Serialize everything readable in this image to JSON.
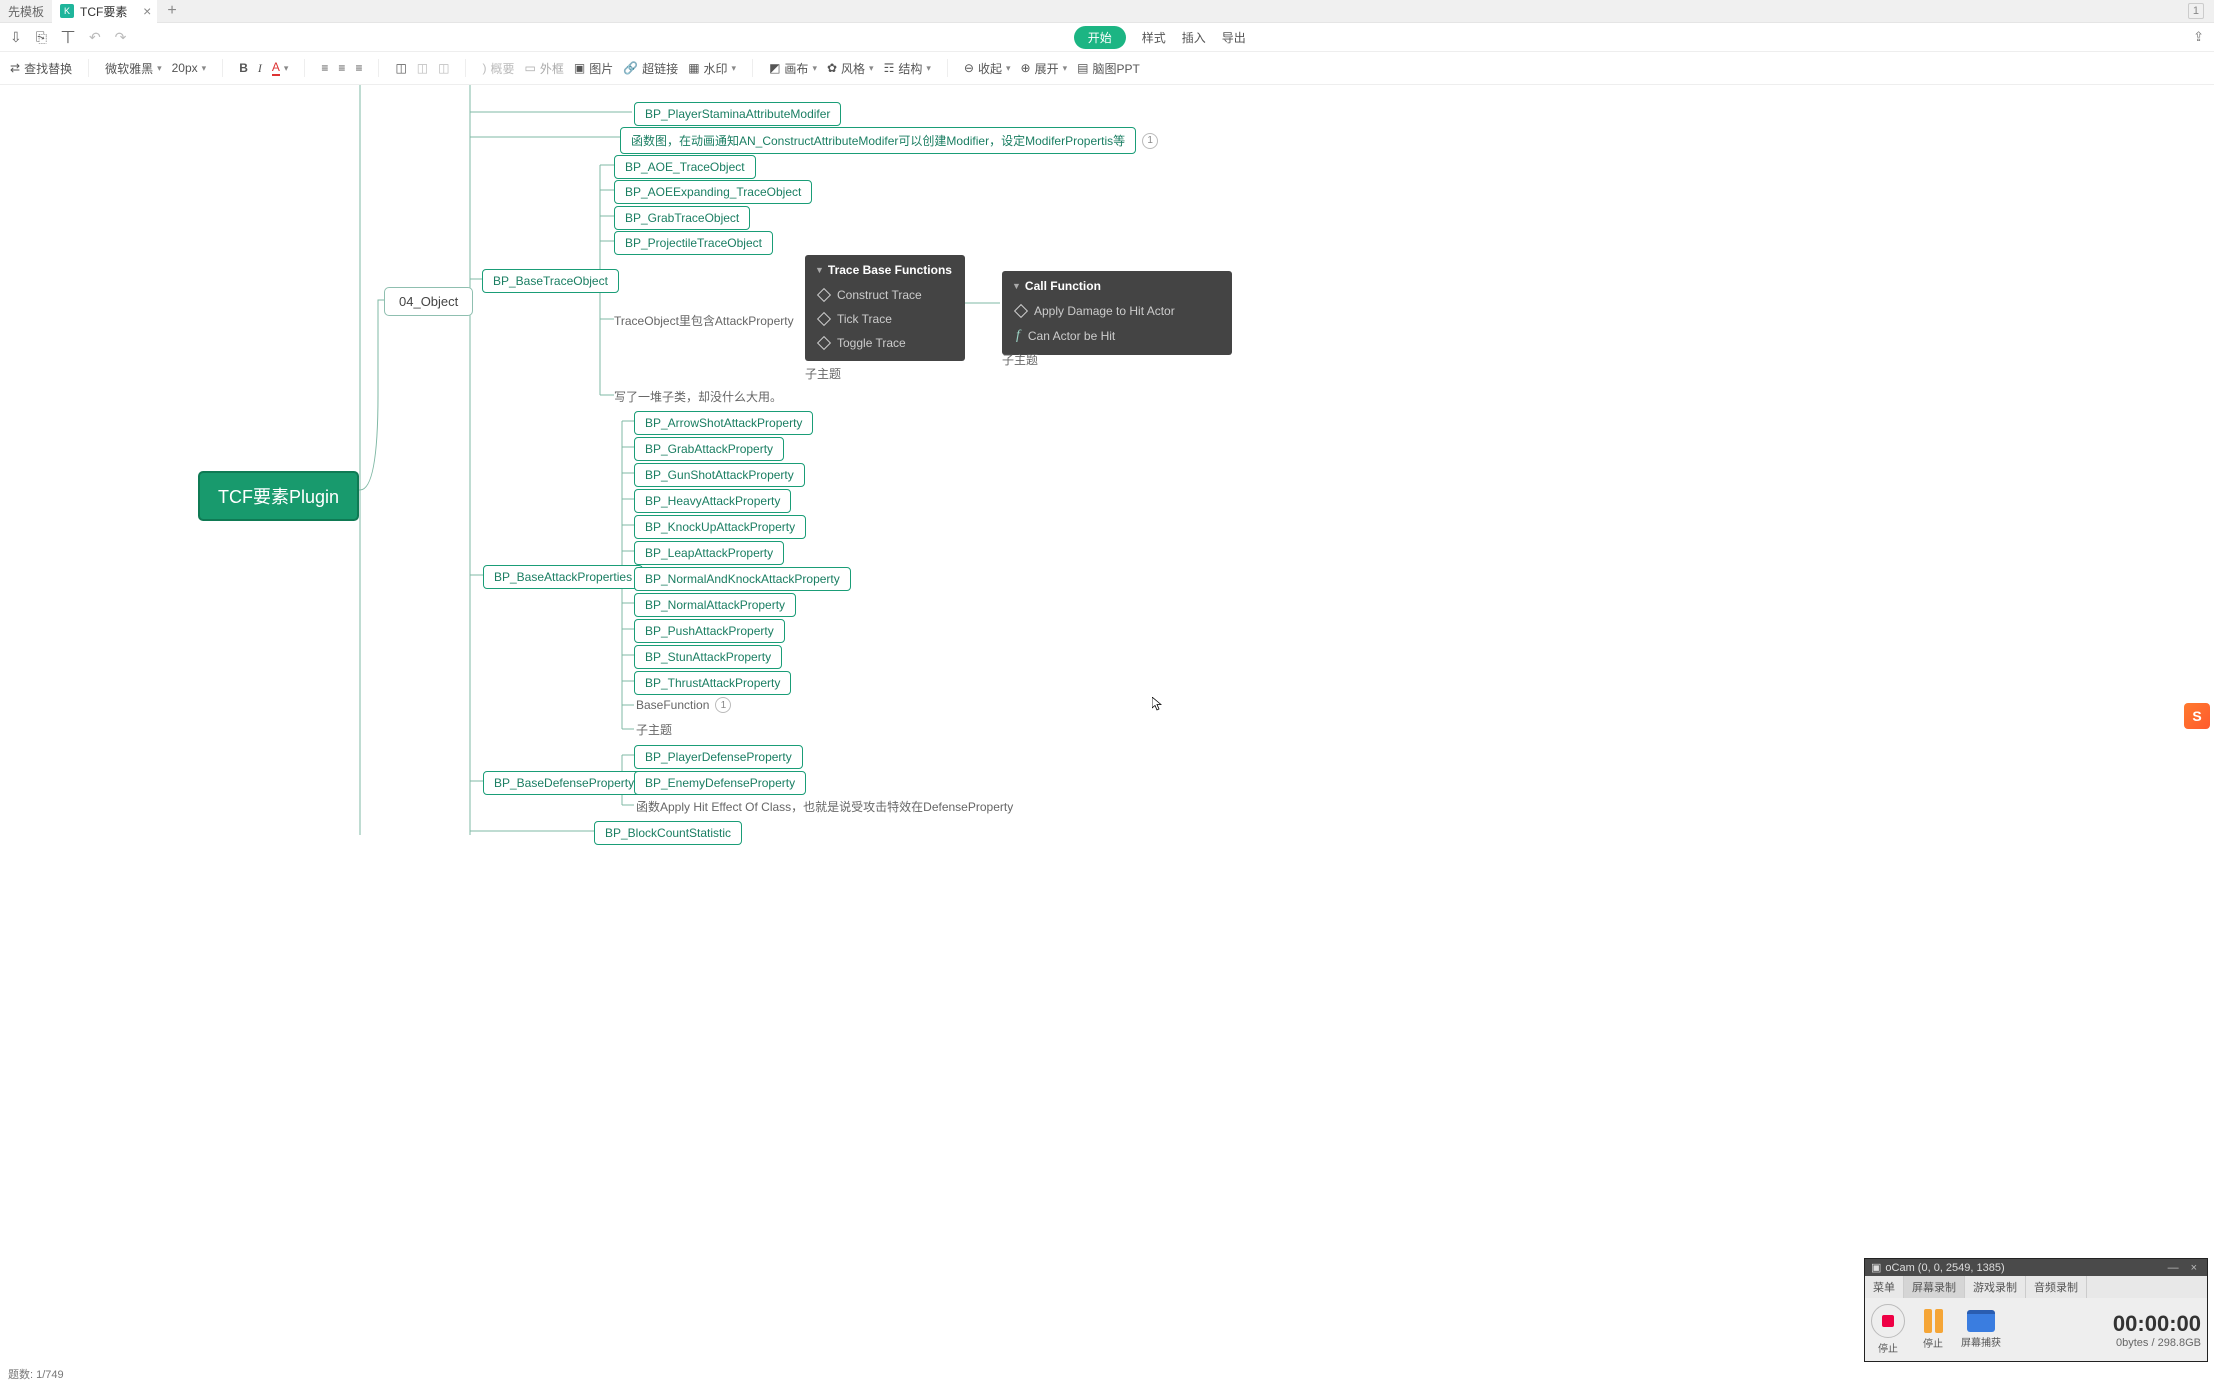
{
  "tabs": {
    "grayTab": "先模板",
    "activeTab": "TCF要素"
  },
  "menubar": {
    "start": "开始",
    "style": "样式",
    "insert": "插入",
    "export": "导出"
  },
  "toolbar": {
    "findReplace": "查找替换",
    "font": "微软雅黑",
    "fontSize": "20px",
    "outline": "概要",
    "frame": "外框",
    "image": "图片",
    "link": "超链接",
    "watermark": "水印",
    "canvas": "画布",
    "style": "风格",
    "structure": "结构",
    "collapse": "收起",
    "expand": "展开",
    "brainPPT": "脑图PPT"
  },
  "mindmap": {
    "root": "TCF要素Plugin",
    "level2": "04_Object",
    "bp_player_stamina": "BP_PlayerStaminaAttributeModifer",
    "modifier_note": "函数图，在动画通知AN_ConstructAttributeModifer可以创建Modifier，设定ModiferPropertis等",
    "modifier_count": "1",
    "base_trace": "BP_BaseTraceObject",
    "trace_children": {
      "aoe": "BP_AOE_TraceObject",
      "aoe_expanding": "BP_AOEExpanding_TraceObject",
      "grab": "BP_GrabTraceObject",
      "projectile": "BP_ProjectileTraceObject"
    },
    "trace_note": "TraceObject里包含AttackProperty",
    "subtopic1": "子主题",
    "subtopic2": "子主题",
    "writeup_note": "写了一堆子类，却没什么大用。",
    "base_attack": "BP_BaseAttackProperties",
    "attack_children": {
      "arrow": "BP_ArrowShotAttackProperty",
      "grab": "BP_GrabAttackProperty",
      "gun": "BP_GunShotAttackProperty",
      "heavy": "BP_HeavyAttackProperty",
      "knockup": "BP_KnockUpAttackProperty",
      "leap": "BP_LeapAttackProperty",
      "normalknock": "BP_NormalAndKnockAttackProperty",
      "normal": "BP_NormalAttackProperty",
      "push": "BP_PushAttackProperty",
      "stun": "BP_StunAttackProperty",
      "thrust": "BP_ThrustAttackProperty"
    },
    "basefunc": "BaseFunction",
    "basefunc_count": "1",
    "subtopic_attack": "子主题",
    "base_defense": "BP_BaseDefenseProperty",
    "defense_children": {
      "player": "BP_PlayerDefenseProperty",
      "enemy": "BP_EnemyDefenseProperty"
    },
    "defense_note": "函数Apply Hit Effect Of Class，也就是说受攻击特效在DefenseProperty",
    "block_count": "BP_BlockCountStatistic"
  },
  "darkPanel1": {
    "title": "Trace Base Functions",
    "items": [
      "Construct Trace",
      "Tick Trace",
      "Toggle Trace"
    ]
  },
  "darkPanel2": {
    "title": "Call Function",
    "items": [
      "Apply Damage to Hit Actor",
      "Can Actor be Hit"
    ]
  },
  "ocam": {
    "title": "oCam (0, 0, 2549, 1385)",
    "menu": "菜单",
    "tabs": [
      "屏幕录制",
      "游戏录制",
      "音频录制"
    ],
    "stop1": "停止",
    "stop2": "停止",
    "capture": "屏幕捕获",
    "time": "00:00:00",
    "size": "0bytes / 298.8GB"
  },
  "status": {
    "count": "题数:  1/749"
  }
}
